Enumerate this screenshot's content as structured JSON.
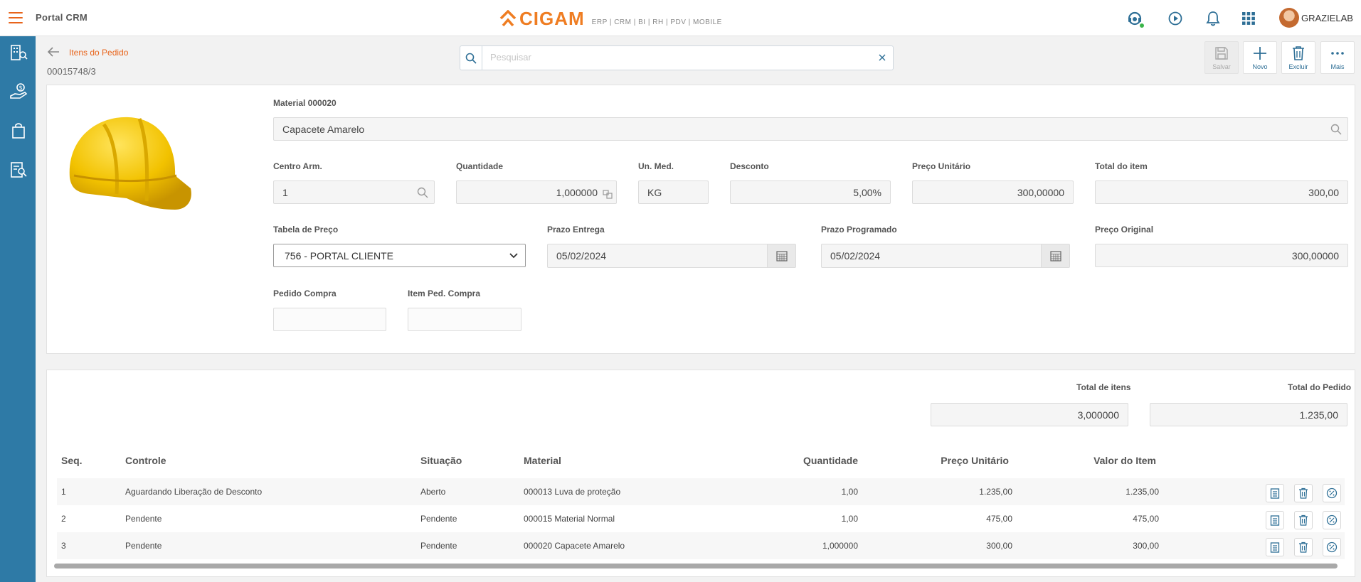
{
  "app": {
    "title": "Portal CRM",
    "logo_text": "CIGAM",
    "logo_tagline": "ERP | CRM | BI | RH | PDV | MOBILE"
  },
  "user": {
    "name": "GRAZIELAB"
  },
  "colors": {
    "accent": "#e8641b",
    "sidebar": "#2e7aa6",
    "link": "#2e6f96"
  },
  "header": {
    "back_label": "Itens do Pedido",
    "order_number": "00015748/3"
  },
  "search": {
    "placeholder": "Pesquisar",
    "value": ""
  },
  "toolbar": {
    "save": "Salvar",
    "new": "Novo",
    "delete": "Excluir",
    "more": "Mais"
  },
  "form": {
    "material_label": "Material 000020",
    "material_value": "Capacete Amarelo",
    "centro_label": "Centro Arm.",
    "centro_value": "1",
    "quantidade_label": "Quantidade",
    "quantidade_value": "1,000000",
    "unmed_label": "Un. Med.",
    "unmed_value": "KG",
    "desconto_label": "Desconto",
    "desconto_value": "5,00%",
    "preco_unit_label": "Preço Unitário",
    "preco_unit_value": "300,00000",
    "total_item_label": "Total do item",
    "total_item_value": "300,00",
    "tabela_label": "Tabela de Preço",
    "tabela_value": "756 - PORTAL CLIENTE",
    "prazo_entrega_label": "Prazo Entrega",
    "prazo_entrega_value": "05/02/2024",
    "prazo_prog_label": "Prazo Programado",
    "prazo_prog_value": "05/02/2024",
    "preco_orig_label": "Preço Original",
    "preco_orig_value": "300,00000",
    "pedido_compra_label": "Pedido Compra",
    "pedido_compra_value": "",
    "item_ped_compra_label": "Item Ped. Compra",
    "item_ped_compra_value": ""
  },
  "totals": {
    "itens_label": "Total de itens",
    "itens_value": "3,000000",
    "pedido_label": "Total do Pedido",
    "pedido_value": "1.235,00"
  },
  "table": {
    "headers": [
      "Seq.",
      "Controle",
      "Situação",
      "Material",
      "Quantidade",
      "Preço Unitário",
      "Valor do Item"
    ],
    "rows": [
      [
        "1",
        "Aguardando Liberação de Desconto",
        "Aberto",
        "000013 Luva de proteção",
        "1,00",
        "1.235,00",
        "1.235,00"
      ],
      [
        "2",
        "Pendente",
        "Pendente",
        "000015 Material Normal",
        "1,00",
        "475,00",
        "475,00"
      ],
      [
        "3",
        "Pendente",
        "Pendente",
        "000020 Capacete Amarelo",
        "1,000000",
        "300,00",
        "300,00"
      ]
    ]
  }
}
